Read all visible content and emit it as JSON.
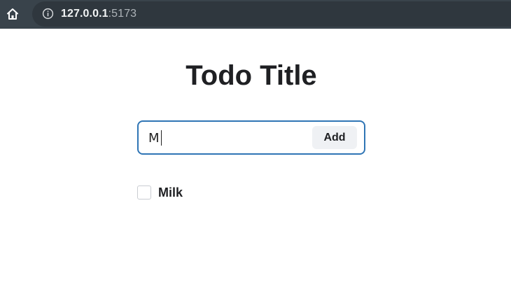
{
  "browser": {
    "url_host": "127.0.0.1",
    "url_port": ":5173",
    "icons": [
      "home-icon",
      "info-icon"
    ]
  },
  "page": {
    "title": "Todo Title"
  },
  "form": {
    "input_value": "M",
    "add_label": "Add",
    "border_color": "#2f75b5"
  },
  "todos": [
    {
      "label": "Milk",
      "checked": false
    }
  ]
}
